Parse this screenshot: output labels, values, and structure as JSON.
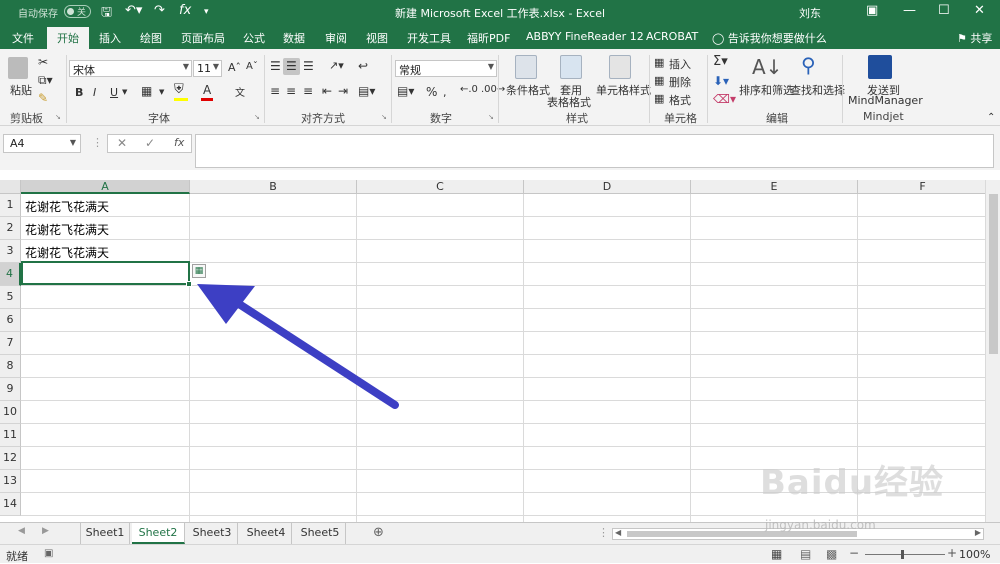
{
  "titlebar": {
    "autosave_label": "自动保存",
    "autosave_state": "关",
    "doc_title": "新建 Microsoft Excel 工作表.xlsx  -  Excel",
    "user": "刘东"
  },
  "tabs": [
    "文件",
    "开始",
    "插入",
    "绘图",
    "页面布局",
    "公式",
    "数据",
    "审阅",
    "视图",
    "开发工具",
    "福昕PDF",
    "ABBYY FineReader 12",
    "ACROBAT"
  ],
  "active_tab": "开始",
  "tell_me": "告诉我你想要做什么",
  "share": "共享",
  "ribbon": {
    "clipboard": {
      "paste": "粘贴",
      "label": "剪贴板"
    },
    "font": {
      "name": "宋体",
      "size": "11",
      "label": "字体",
      "bold": "B",
      "italic": "I",
      "underline": "U"
    },
    "align": {
      "label": "对齐方式"
    },
    "number": {
      "format": "常规",
      "label": "数字",
      "percent": "%"
    },
    "styles": {
      "cond": "条件格式",
      "table1": "套用",
      "table2": "表格格式",
      "cell": "单元格样式",
      "label": "样式"
    },
    "cells": {
      "insert": "插入",
      "delete": "删除",
      "format": "格式",
      "label": "单元格"
    },
    "editing": {
      "sort": "排序和筛选",
      "find": "查找和选择",
      "label": "编辑"
    },
    "mindjet": {
      "send1": "发送到",
      "send2": "MindManager",
      "label": "Mindjet"
    }
  },
  "formula_bar": {
    "name_box": "A4",
    "fx": "fx",
    "content": ""
  },
  "columns": [
    "A",
    "B",
    "C",
    "D",
    "E",
    "F"
  ],
  "rows": [
    "1",
    "2",
    "3",
    "4",
    "5",
    "6",
    "7",
    "8",
    "9",
    "10",
    "11",
    "12",
    "13",
    "14"
  ],
  "cells": {
    "A1": "花谢花飞花满天",
    "A2": "花谢花飞花满天",
    "A3": "花谢花飞花满天"
  },
  "selected_cell": "A4",
  "sheets": [
    "Sheet1",
    "Sheet2",
    "Sheet3",
    "Sheet4",
    "Sheet5"
  ],
  "active_sheet": "Sheet2",
  "status": {
    "ready": "就绪",
    "zoom": "100%"
  },
  "watermark": {
    "brand": "Baidu经验",
    "url": "jingyan.baidu.com"
  },
  "colors": {
    "accent": "#217346",
    "arrow": "#3d3fc4"
  }
}
